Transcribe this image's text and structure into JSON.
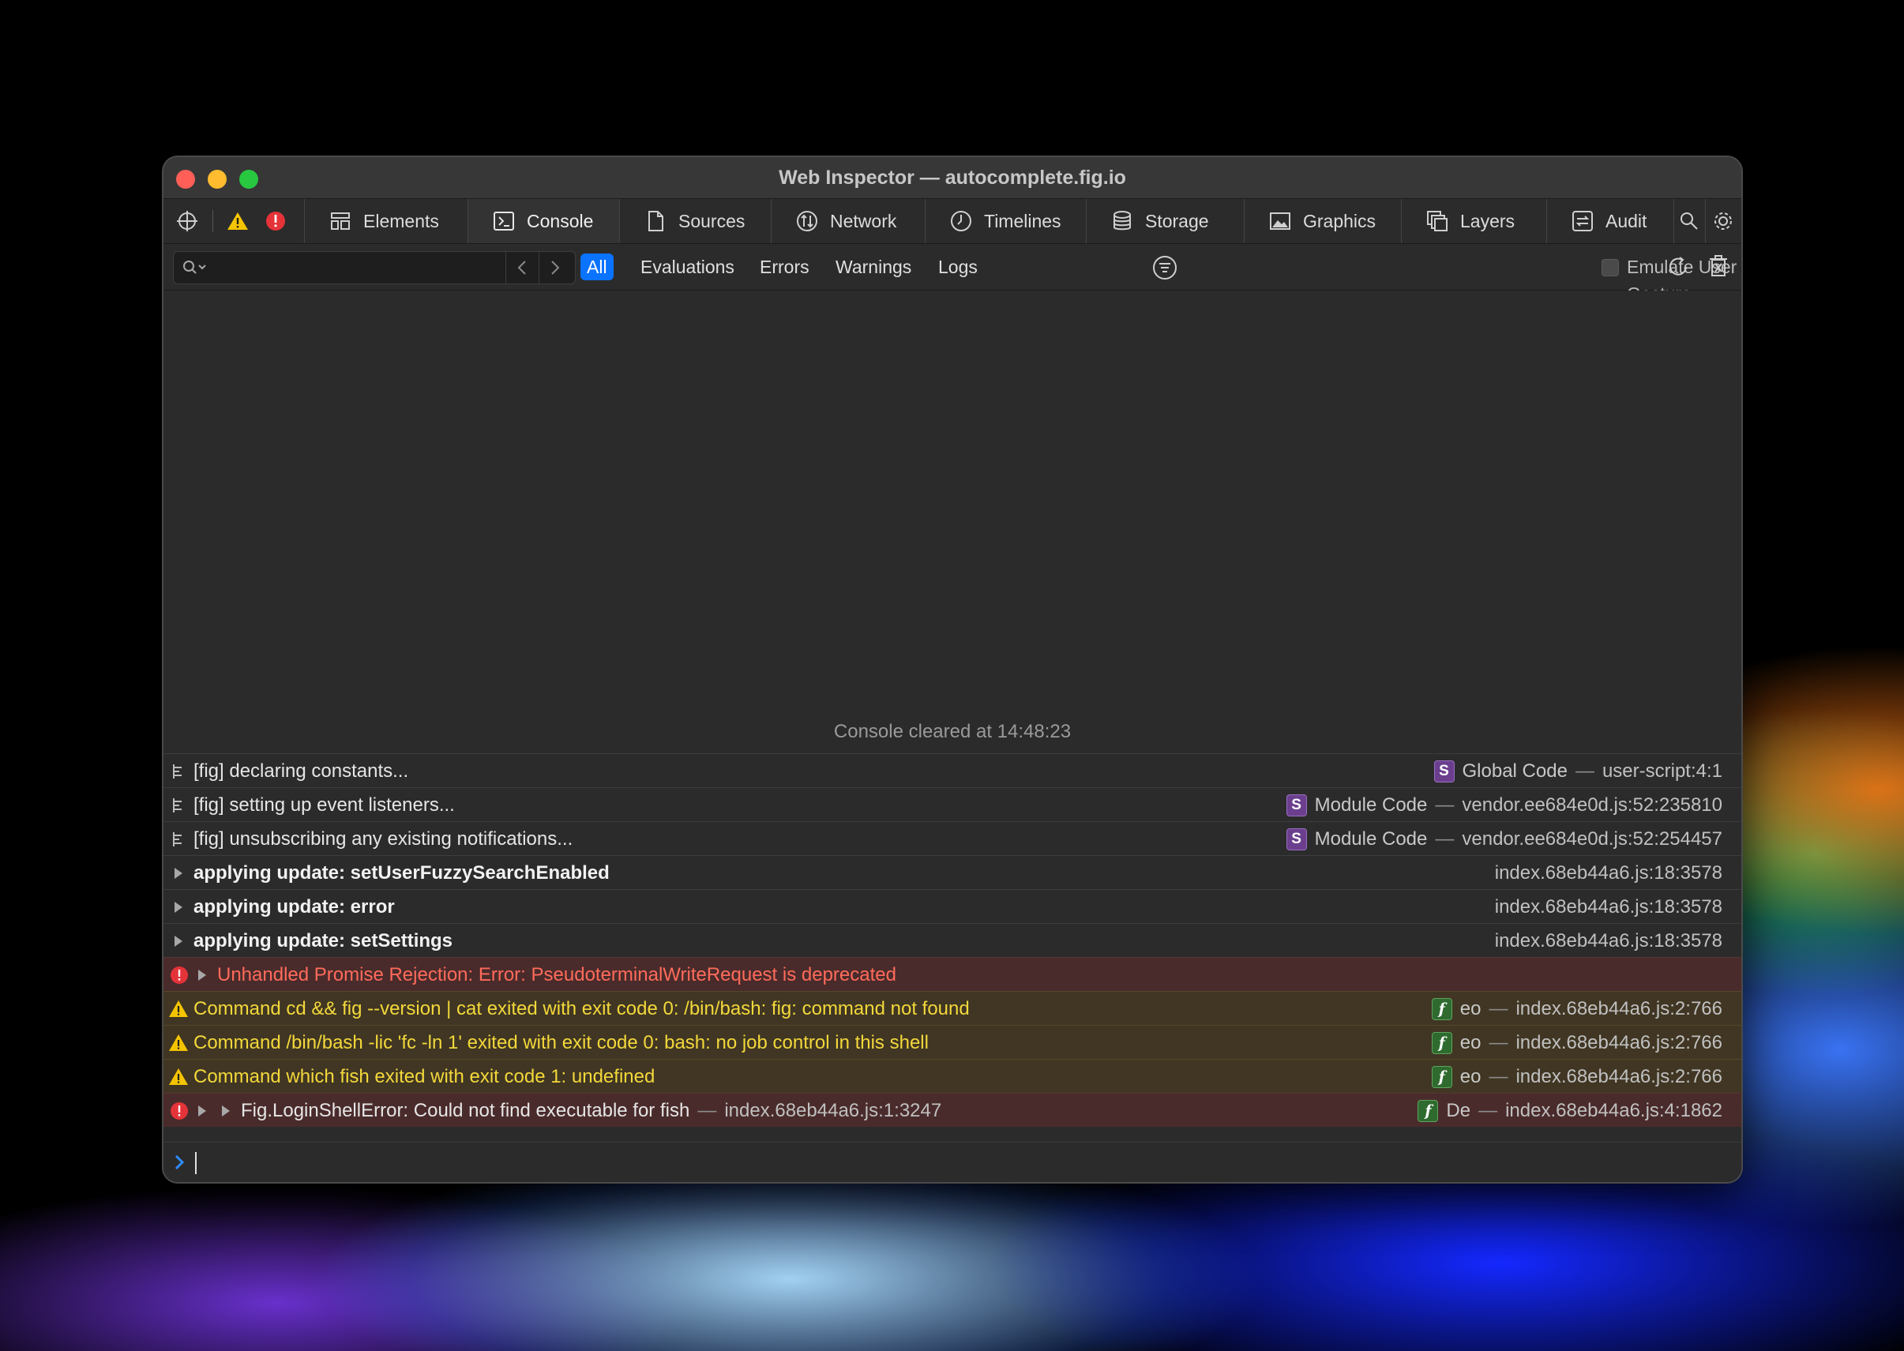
{
  "window": {
    "title": "Web Inspector — autocomplete.fig.io"
  },
  "tabs": [
    {
      "label": "Elements",
      "icon": "elements-icon",
      "active": false
    },
    {
      "label": "Console",
      "icon": "console-icon",
      "active": true
    },
    {
      "label": "Sources",
      "icon": "sources-icon",
      "active": false
    },
    {
      "label": "Network",
      "icon": "network-icon",
      "active": false
    },
    {
      "label": "Timelines",
      "icon": "timelines-icon",
      "active": false
    },
    {
      "label": "Storage",
      "icon": "storage-icon",
      "active": false
    },
    {
      "label": "Graphics",
      "icon": "graphics-icon",
      "active": false
    },
    {
      "label": "Layers",
      "icon": "layers-icon",
      "active": false
    },
    {
      "label": "Audit",
      "icon": "audit-icon",
      "active": false
    }
  ],
  "filters": {
    "search_placeholder": "",
    "chips": [
      "All",
      "Evaluations",
      "Errors",
      "Warnings",
      "Logs"
    ],
    "active_chip": "All",
    "emulate_label": "Emulate User Gesture"
  },
  "console": {
    "cleared_message": "Console cleared at 14:48:23",
    "rows": [
      {
        "type": "log",
        "message": "[fig] declaring constants...",
        "badge": "S",
        "func": "Global Code",
        "source": "user-script:4:1"
      },
      {
        "type": "log",
        "message": "[fig] setting up event listeners...",
        "badge": "S",
        "func": "Module Code",
        "source": "vendor.ee684e0d.js:52:235810"
      },
      {
        "type": "log",
        "message": "[fig] unsubscribing any existing notifications...",
        "badge": "S",
        "func": "Module Code",
        "source": "vendor.ee684e0d.js:52:254457"
      },
      {
        "type": "group",
        "message": "applying update: setUserFuzzySearchEnabled",
        "source": "index.68eb44a6.js:18:3578"
      },
      {
        "type": "group",
        "message": "applying update: error",
        "source": "index.68eb44a6.js:18:3578"
      },
      {
        "type": "group",
        "message": "applying update: setSettings",
        "source": "index.68eb44a6.js:18:3578"
      },
      {
        "type": "error",
        "message": "Unhandled Promise Rejection: Error: PseudoterminalWriteRequest is deprecated"
      },
      {
        "type": "warning",
        "message": "Command cd  && fig --version | cat exited with exit code 0: /bin/bash: fig: command not found",
        "badge": "f",
        "func": "eo",
        "source": "index.68eb44a6.js:2:766"
      },
      {
        "type": "warning",
        "message": "Command /bin/bash -lic 'fc -ln 1' exited with exit code 0: bash: no job control in this shell",
        "badge": "f",
        "func": "eo",
        "source": "index.68eb44a6.js:2:766"
      },
      {
        "type": "warning",
        "message": "Command which fish exited with exit code 1: undefined",
        "badge": "f",
        "func": "eo",
        "source": "index.68eb44a6.js:2:766"
      },
      {
        "type": "error2",
        "message": "Fig.LoginShellError: Could not find executable for fish",
        "inline_source": "index.68eb44a6.js:1:3247",
        "badge": "f",
        "func": "De",
        "source": "index.68eb44a6.js:4:1862"
      }
    ]
  },
  "colors": {
    "accent": "#0a73ff",
    "error_text": "#ff6b5b",
    "warning_text": "#f3d83b"
  }
}
